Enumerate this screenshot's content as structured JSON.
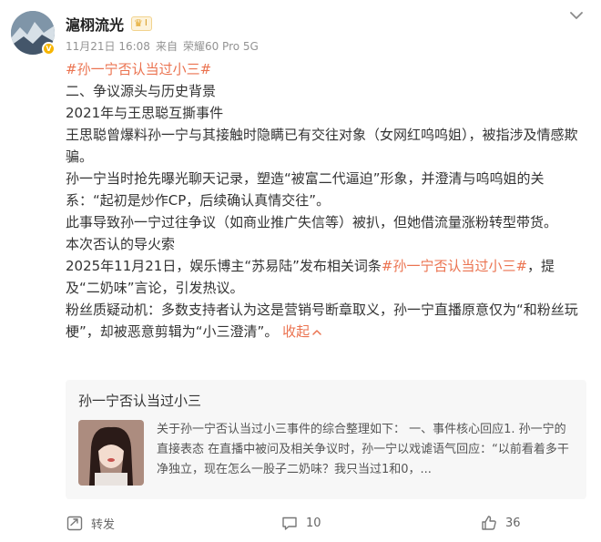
{
  "post": {
    "username": "滬栩流光",
    "level": "I",
    "meta": {
      "time": "11月21日 16:08",
      "source_prefix": "来自",
      "device": "荣耀60 Pro 5G"
    },
    "body": {
      "topic_tag": "#孙一宁否认当过小三#",
      "section_heading": "二、争议源头与历史背景",
      "sub_heading_1": "2021年与王思聪互撕事件",
      "para_1": "王思聪曾爆料孙一宁与其接触时隐瞒已有交往对象（女网红呜呜姐），被指涉及情感欺骗。",
      "para_2": "孙一宁当时抢先曝光聊天记录，塑造“被富二代逼迫”形象，并澄清与呜呜姐的关系：“起初是炒作CP，后续确认真情交往”。",
      "para_3": "此事导致孙一宁过往争议（如商业推广失信等）被扒，但她借流量涨粉转型带货。",
      "sub_heading_2": "本次否认的导火索",
      "para_4_before": "2025年11月21日，娱乐博主“苏易陆”发布相关词条",
      "para_4_tag": "#孙一宁否认当过小三#",
      "para_4_after": "，提及“二奶味”言论，引发热议。",
      "para_5": "粉丝质疑动机：多数支持者认为这是营销号断章取义，孙一宁直播原意仅为“和粉丝玩梗”，却被恶意剪辑为“小三澄清”。",
      "collapse_label": "收起"
    },
    "card": {
      "title": "孙一宁否认当过小三",
      "description": "关于孙一宁否认当过小三事件的综合整理如下： 一、事件核心回应1. 孙一宁的直接表态 在直播中被问及相关争议时，孙一宁以戏谑语气回应：“以前看着多干净独立，现在怎么一股子二奶味？我只当过1和0，..."
    },
    "actions": {
      "repost_label": "转发",
      "comment_count": "10",
      "like_count": "36"
    }
  },
  "colors": {
    "accent": "#eb7350",
    "meta": "#939393",
    "card_bg": "#f7f7f7",
    "level_gold": "#e3a422"
  },
  "icons": [
    "chevron-down-icon",
    "verified-v-icon",
    "crown-icon",
    "repost-icon",
    "comment-icon",
    "like-icon"
  ]
}
